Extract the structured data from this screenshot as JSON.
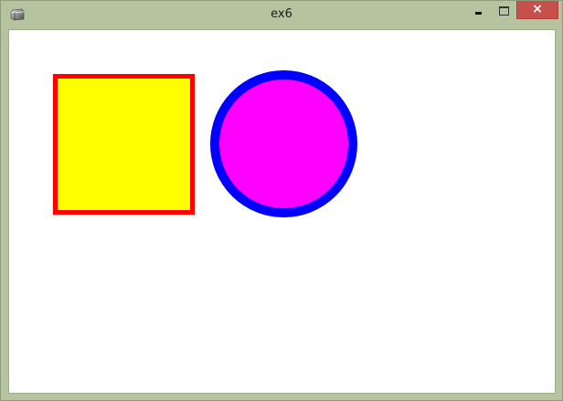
{
  "window": {
    "title": "ex6",
    "close_label": "×"
  },
  "colors": {
    "titlebar": "#b5c49f",
    "close_button": "#c7504b",
    "client_background": "#ffffff"
  },
  "canvas": {
    "shapes": [
      {
        "kind": "rectangle",
        "fill": "#ffff00",
        "stroke": "#ff0000"
      },
      {
        "kind": "circle",
        "fill": "#ff00ff",
        "stroke": "#0000ff"
      }
    ]
  },
  "icons": {
    "app": "app-icon",
    "minimize": "minimize-icon",
    "maximize": "maximize-icon",
    "close": "close-icon"
  }
}
